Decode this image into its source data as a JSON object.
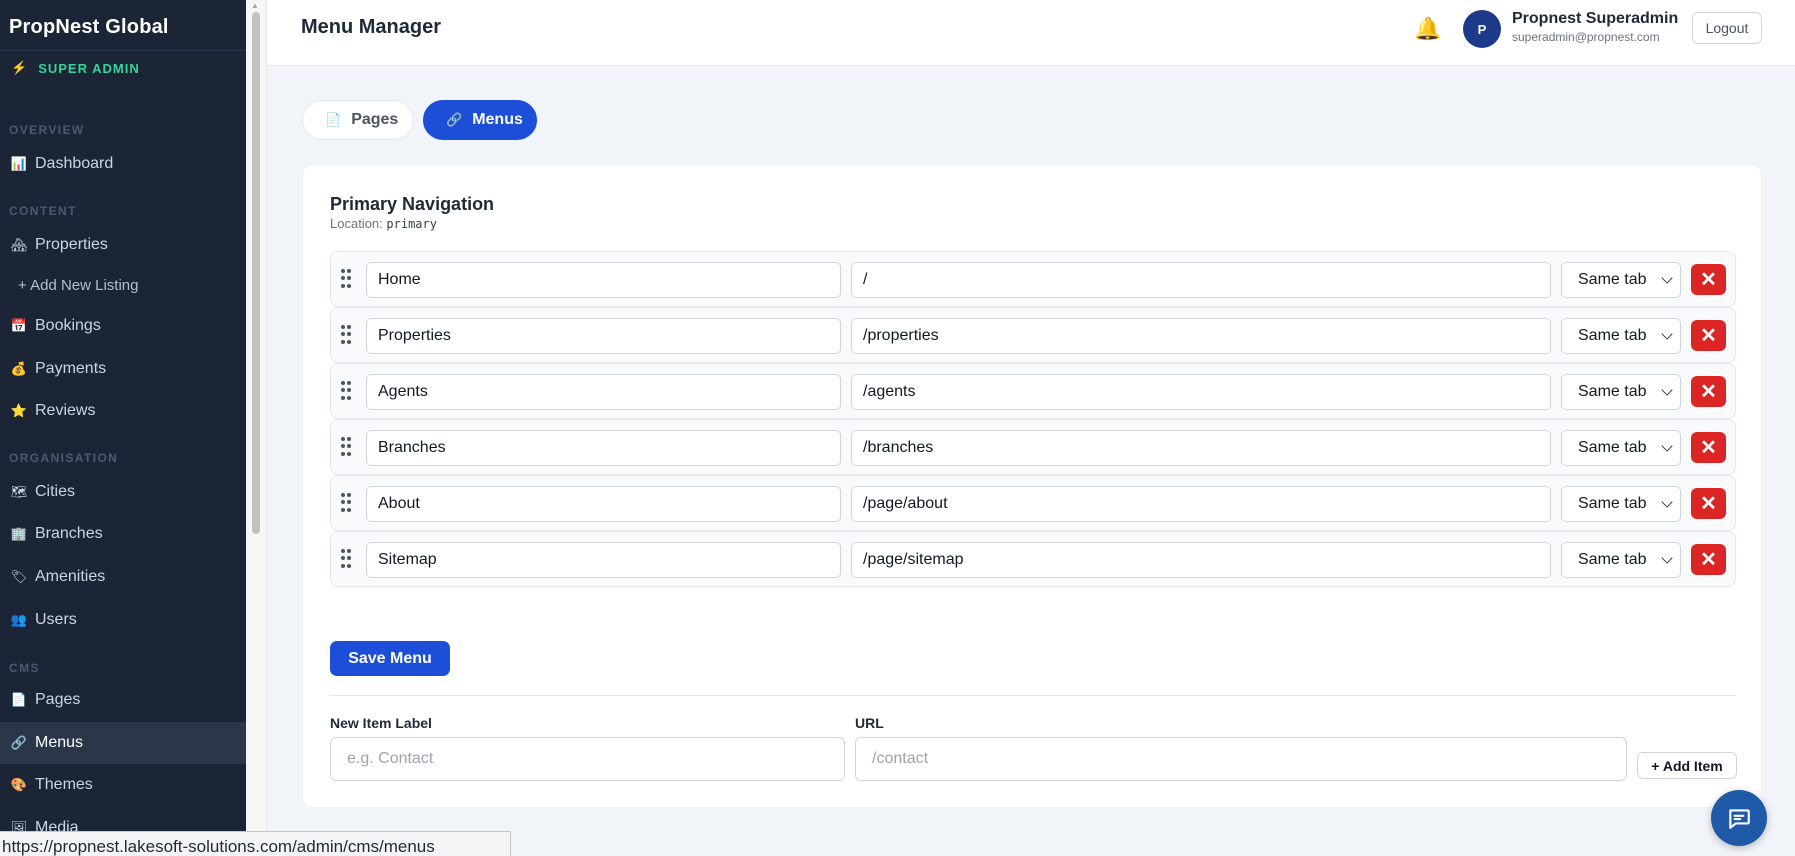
{
  "sidebar": {
    "brand": "PropNest Global",
    "role": "SUPER ADMIN",
    "sections": {
      "overview": "OVERVIEW",
      "content": "CONTENT",
      "organisation": "ORGANISATION",
      "cms": "CMS"
    },
    "items": {
      "dashboard": "Dashboard",
      "properties": "Properties",
      "add_listing": "+ Add New Listing",
      "bookings": "Bookings",
      "payments": "Payments",
      "reviews": "Reviews",
      "cities": "Cities",
      "branches": "Branches",
      "amenities": "Amenities",
      "users": "Users",
      "pages": "Pages",
      "menus": "Menus",
      "themes": "Themes",
      "media": "Media"
    },
    "active_item": "Menus"
  },
  "header": {
    "title": "Menu Manager",
    "avatar_initial": "P",
    "user_name": "Propnest Superadmin",
    "user_email": "superadmin@propnest.com",
    "logout_label": "Logout"
  },
  "tabs": {
    "pages": "Pages",
    "menus": "Menus",
    "active": "Menus"
  },
  "menu": {
    "title": "Primary Navigation",
    "location_label": "Location:",
    "location_value": "primary",
    "items": [
      {
        "label": "Home",
        "url": "/",
        "target": "Same tab"
      },
      {
        "label": "Properties",
        "url": "/properties",
        "target": "Same tab"
      },
      {
        "label": "Agents",
        "url": "/agents",
        "target": "Same tab"
      },
      {
        "label": "Branches",
        "url": "/branches",
        "target": "Same tab"
      },
      {
        "label": "About",
        "url": "/page/about",
        "target": "Same tab"
      },
      {
        "label": "Sitemap",
        "url": "/page/sitemap",
        "target": "Same tab"
      }
    ],
    "save_label": "Save Menu",
    "new_item": {
      "label_heading": "New Item Label",
      "label_placeholder": "e.g. Contact",
      "url_heading": "URL",
      "url_placeholder": "/contact",
      "add_label": "+ Add Item"
    }
  },
  "status_url": "https://propnest.lakesoft-solutions.com/admin/cms/menus",
  "colors": {
    "primary": "#1d4ed8",
    "danger": "#dc2626",
    "sidebar_bg": "#1c2536",
    "role_accent": "#34d399"
  }
}
